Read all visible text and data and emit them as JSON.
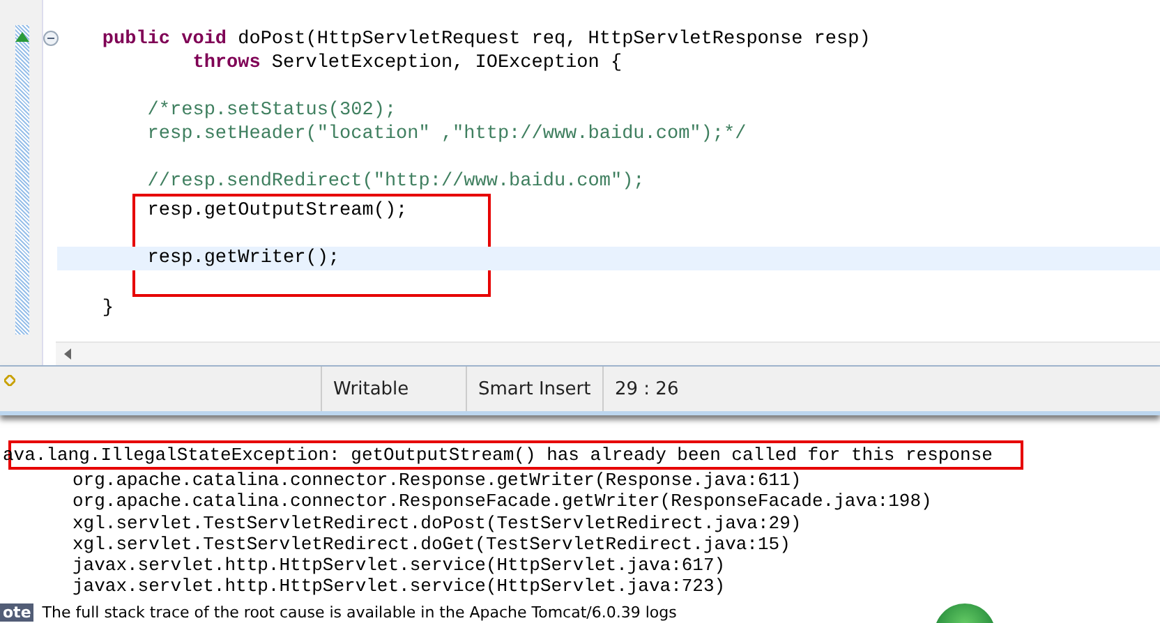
{
  "editor": {
    "blocks": [
      {
        "boxed": false,
        "lines": [
          {
            "kind": "code",
            "current": false,
            "segments": [
              {
                "kind": "keyword",
                "text": "    public void"
              },
              {
                "kind": "plain",
                "text": " doPost(HttpServletRequest req, HttpServletResponse resp)"
              }
            ]
          },
          {
            "kind": "code",
            "current": false,
            "segments": [
              {
                "kind": "keyword",
                "text": "            throws"
              },
              {
                "kind": "plain",
                "text": " ServletException, IOException {"
              }
            ]
          },
          {
            "kind": "blank",
            "current": false
          },
          {
            "kind": "code",
            "current": false,
            "segments": [
              {
                "kind": "comment",
                "text": "        /*resp.setStatus(302);"
              }
            ]
          },
          {
            "kind": "code",
            "current": false,
            "segments": [
              {
                "kind": "comment",
                "text": "        resp.setHeader(\"location\" ,\"http://www.baidu.com\");*/"
              }
            ]
          },
          {
            "kind": "blank",
            "current": false
          },
          {
            "kind": "code",
            "current": false,
            "segments": [
              {
                "kind": "comment",
                "text": "        //resp.sendRedirect(\"http://www.baidu.com\");"
              }
            ]
          }
        ]
      },
      {
        "boxed": true,
        "lines": [
          {
            "kind": "code",
            "current": false,
            "segments": [
              {
                "kind": "plain",
                "text": "        resp.getOutputStream();"
              }
            ]
          },
          {
            "kind": "blank",
            "current": false
          },
          {
            "kind": "code",
            "current": true,
            "segments": [
              {
                "kind": "plain",
                "text": "        resp.getWriter();"
              }
            ]
          },
          {
            "kind": "blank",
            "current": false
          }
        ]
      },
      {
        "boxed": false,
        "lines": [
          {
            "kind": "code",
            "current": false,
            "segments": [
              {
                "kind": "plain",
                "text": "    }"
              }
            ]
          }
        ]
      }
    ]
  },
  "status_bar": {
    "fields": [
      "Writable",
      "Smart Insert",
      "29 : 26"
    ]
  },
  "browser": {
    "exception": {
      "text": "ava.lang.IllegalStateException: getOutputStream() has already been called for this response",
      "boxed": true
    },
    "stack": [
      "org.apache.catalina.connector.Response.getWriter(Response.java:611)",
      "org.apache.catalina.connector.ResponseFacade.getWriter(ResponseFacade.java:198)",
      "xgl.servlet.TestServletRedirect.doPost(TestServletRedirect.java:29)",
      "xgl.servlet.TestServletRedirect.doGet(TestServletRedirect.java:15)",
      "javax.servlet.http.HttpServlet.service(HttpServlet.java:617)",
      "javax.servlet.http.HttpServlet.service(HttpServlet.java:723)"
    ],
    "note_label": "ote",
    "note": "The full stack trace of the root cause is available in the Apache Tomcat/6.0.39 logs"
  }
}
